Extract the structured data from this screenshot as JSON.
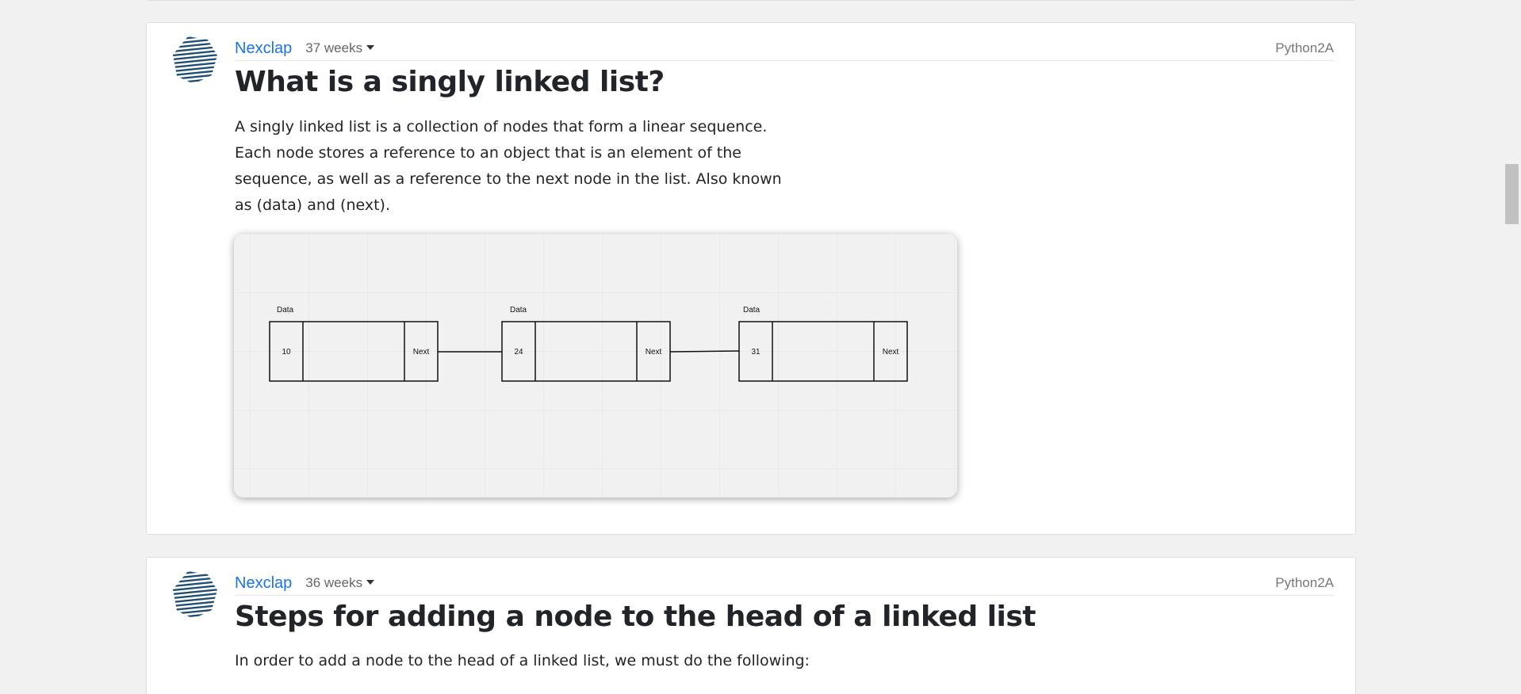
{
  "posts": [
    {
      "author": "Nexclap",
      "age": "37 weeks",
      "category": "Python2A",
      "title": "What is a singly linked list?",
      "body": "A singly linked list is a collection of nodes that form a linear sequence. Each node stores a reference to an object that is an element of the sequence, as well as a reference to the next node in the list. Also known as (data) and (next).",
      "diagram": {
        "nodes": [
          {
            "label": "Data",
            "value": "10",
            "next": "Next"
          },
          {
            "label": "Data",
            "value": "24",
            "next": "Next"
          },
          {
            "label": "Data",
            "value": "31",
            "next": "Next"
          }
        ]
      }
    },
    {
      "author": "Nexclap",
      "age": "36 weeks",
      "category": "Python2A",
      "title": "Steps for adding a node to the head of a linked list",
      "body": "In order to add a node to the head of a linked list, we must do the following:"
    }
  ],
  "colors": {
    "link": "#1a73e8",
    "avatar": "#1f4e73"
  },
  "icons": {
    "avatar": "striped-polygon-avatar-icon",
    "age_toggle": "caret-down-icon"
  }
}
